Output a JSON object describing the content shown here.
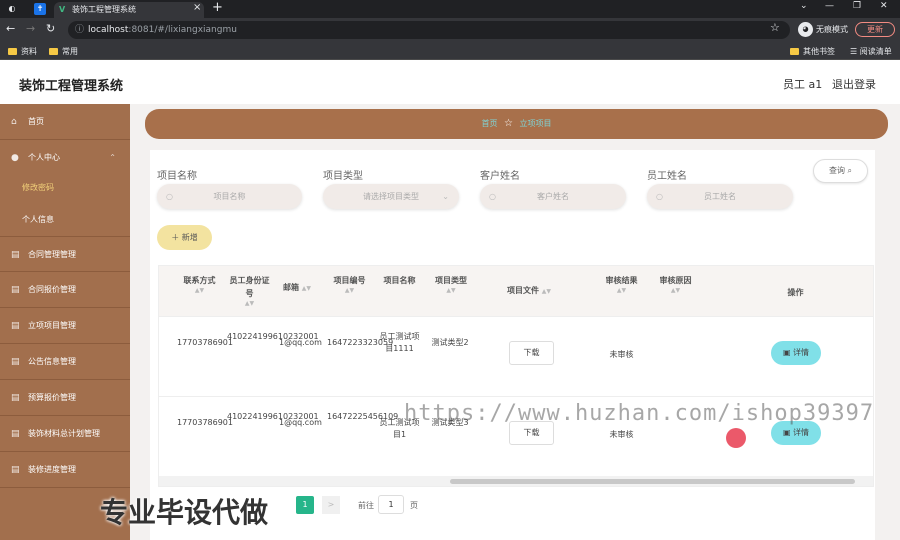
{
  "browser": {
    "tab_title": "装饰工程管理系统",
    "tab_close": "×",
    "new_tab": "+",
    "url_host": "localhost",
    "url_path": ":8081/#/lixiangxiangmu",
    "profile_label": "无痕模式",
    "update_label": "更新",
    "bookmarks": [
      "资料",
      "常用"
    ],
    "bookmarks_right": [
      "其他书签",
      "阅读清单"
    ]
  },
  "header": {
    "title": "装饰工程管理系统",
    "user": "员工 a1",
    "logout": "退出登录"
  },
  "sidebar": {
    "home": "首页",
    "personal": "个人中心",
    "sub_password": "修改密码",
    "sub_info": "个人信息",
    "items": [
      "合同管理管理",
      "合同报价管理",
      "立项项目管理",
      "公告信息管理",
      "预算报价管理",
      "装饰材料总计划管理",
      "装修进度管理"
    ]
  },
  "breadcrumb": {
    "home": "首页",
    "current": "立项项目"
  },
  "filters": {
    "project_name_label": "项目名称",
    "project_name_placeholder": "项目名称",
    "project_type_label": "项目类型",
    "project_type_placeholder": "请选择项目类型",
    "customer_label": "客户姓名",
    "customer_placeholder": "客户姓名",
    "employee_label": "员工姓名",
    "employee_placeholder": "员工姓名",
    "query_button": "查询",
    "add_button": "新增"
  },
  "table": {
    "headers": {
      "phone": "联系方式",
      "id_card": "员工身份证号",
      "email": "邮箱",
      "project_no": "项目编号",
      "project_name": "项目名称",
      "project_type": "项目类型",
      "project_file": "项目文件",
      "review_result": "审核结果",
      "review_reason": "审核原因",
      "actions": "操作"
    },
    "rows": [
      {
        "phone": "17703786901",
        "id_card": "410224199610232001",
        "email": "1@qq.com",
        "project_no": "1647223323059",
        "project_name": "员工测试项目1111",
        "project_type": "测试类型2",
        "file_button": "下载",
        "review_result": "未审核",
        "review_reason": "",
        "detail_button": "详情"
      },
      {
        "phone": "17703786901",
        "id_card": "410224199610232001",
        "email": "1@qq.com",
        "project_no": "16472225456109",
        "project_name": "员工测试项目1",
        "project_type": "测试类型3",
        "file_button": "下载",
        "review_result": "未审核",
        "review_reason": "",
        "detail_button": "详情"
      }
    ]
  },
  "pagination": {
    "current_page": "1",
    "next": ">",
    "goto_label": "前往",
    "goto_value": "1",
    "page_unit": "页"
  },
  "overlay": {
    "watermark": "https://www.huzhan.com/ishop39397",
    "caption": "专业毕设代做"
  },
  "colors": {
    "sidebar": "#a26f4d",
    "breadcrumb": "#a8704b",
    "pager_active": "#26b58a",
    "detail_button": "#80e0e8",
    "add_button": "#f3e3a0"
  }
}
